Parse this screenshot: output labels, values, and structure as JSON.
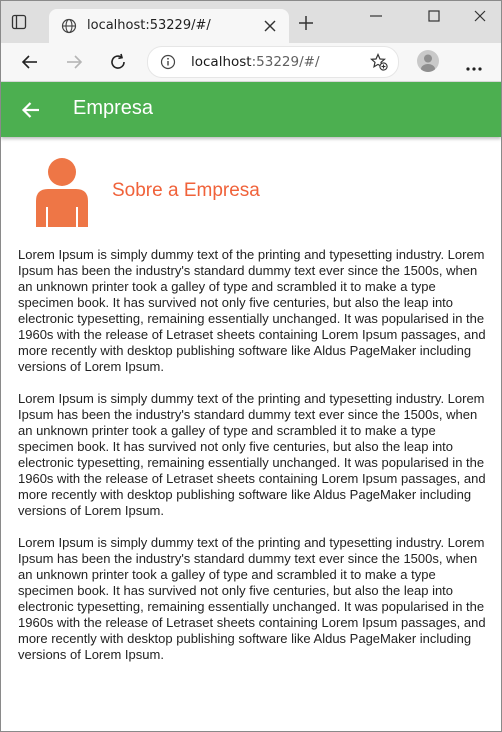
{
  "browser": {
    "tab": {
      "title": "localhost:53229/#/"
    },
    "address": {
      "host": "localhost",
      "rest": ":53229/#/"
    }
  },
  "appbar": {
    "title": "Empresa"
  },
  "section": {
    "title": "Sobre a Empresa"
  },
  "paragraphs": [
    "Lorem Ipsum is simply dummy text of the printing and typesetting industry. Lorem Ipsum has been the industry's standard dummy text ever since the 1500s, when an unknown printer took a galley of type and scrambled it to make a type specimen book. It has survived not only five centuries, but also the leap into electronic typesetting, remaining essentially unchanged. It was popularised in the 1960s with the release of Letraset sheets containing Lorem Ipsum passages, and more recently with desktop publishing software like Aldus PageMaker including versions of Lorem Ipsum.",
    "Lorem Ipsum is simply dummy text of the printing and typesetting industry. Lorem Ipsum has been the industry's standard dummy text ever since the 1500s, when an unknown printer took a galley of type and scrambled it to make a type specimen book. It has survived not only five centuries, but also the leap into electronic typesetting, remaining essentially unchanged. It was popularised in the 1960s with the release of Letraset sheets containing Lorem Ipsum passages, and more recently with desktop publishing software like Aldus PageMaker including versions of Lorem Ipsum.",
    "Lorem Ipsum is simply dummy text of the printing and typesetting industry. Lorem Ipsum has been the industry's standard dummy text ever since the 1500s, when an unknown printer took a galley of type and scrambled it to make a type specimen book. It has survived not only five centuries, but also the leap into electronic typesetting, remaining essentially unchanged. It was popularised in the 1960s with the release of Letraset sheets containing Lorem Ipsum passages, and more recently with desktop publishing software like Aldus PageMaker including versions of Lorem Ipsum."
  ],
  "icons": {
    "tab_actions": "tab-actions-icon",
    "favicon": "globe-icon",
    "close": "close-icon",
    "new_tab": "plus-icon",
    "back": "arrow-left-icon",
    "forward": "arrow-right-icon",
    "refresh": "refresh-icon",
    "info": "info-icon",
    "favorites": "star-plus-icon",
    "profile": "avatar-icon",
    "more": "more-horizontal-icon",
    "person": "person-icon"
  },
  "colors": {
    "appbar": "#4caf50",
    "accent": "#f0623a",
    "person_icon": "#ee7646"
  }
}
